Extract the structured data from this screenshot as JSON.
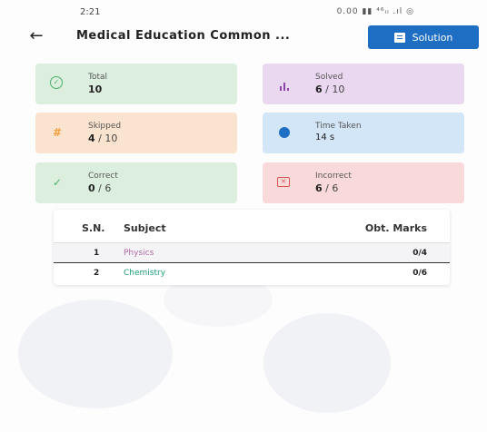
{
  "status_bar": {
    "time": "2:21",
    "icons": "0.00 ▮▮ ⁴⁶ᵢₗ .ıl ◎"
  },
  "app_bar": {
    "back_icon": "arrow-left-icon",
    "title": "Medical Education Common ...",
    "solution_label": "Solution",
    "solution_icon": "document-icon",
    "solution_color": "#1e6fc4"
  },
  "stats": {
    "total": {
      "label": "Total",
      "value": "10",
      "icon": "check-circle-icon",
      "color": "#dcefdf"
    },
    "solved": {
      "label": "Solved",
      "value": "6",
      "denominator": " / 10",
      "icon": "bar-chart-icon",
      "color": "#ead8f1"
    },
    "skipped": {
      "label": "Skipped",
      "value": "4",
      "denominator": " / 10",
      "icon": "hash-icon",
      "color": "#fbe4cf"
    },
    "time_taken": {
      "label": "Time Taken",
      "value": "14 s",
      "icon": "clock-icon",
      "color": "#d3e6f8"
    },
    "correct": {
      "label": "Correct",
      "value": "0",
      "denominator": " / 6",
      "icon": "checkmark-icon",
      "color": "#dcefdf"
    },
    "incorrect": {
      "label": "Incorrect",
      "value": "6",
      "denominator": " / 6",
      "icon": "close-box-icon",
      "color": "#f9d9d9"
    }
  },
  "table": {
    "headers": {
      "sn": "S.N.",
      "subject": "Subject",
      "marks": "Obt. Marks"
    },
    "rows": [
      {
        "sn": "1",
        "subject": "Physics",
        "marks": "0/4",
        "subject_color": "#b36aa8"
      },
      {
        "sn": "2",
        "subject": "Chemistry",
        "marks": "0/6",
        "subject_color": "#1e9e7a"
      }
    ]
  }
}
